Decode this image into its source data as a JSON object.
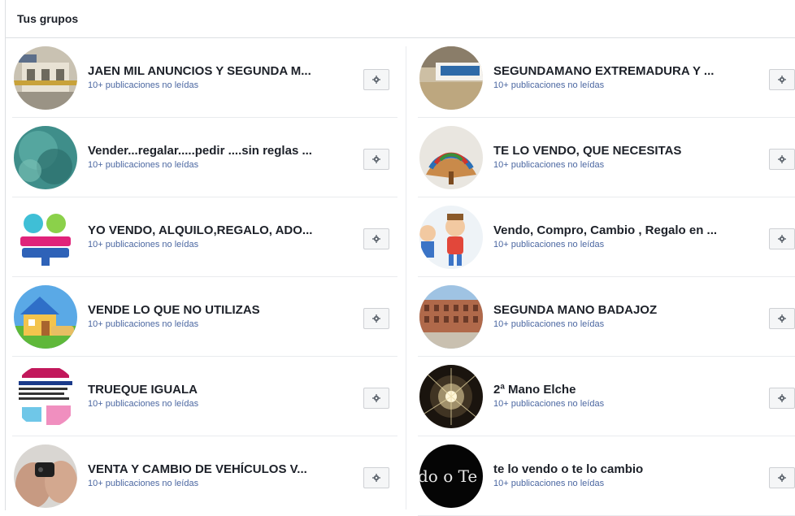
{
  "header": {
    "title": "Tus grupos"
  },
  "left": [
    {
      "name": "JAEN MIL ANUNCIOS Y SEGUNDA M...",
      "sub": "10+ publicaciones no leídas",
      "icon": "house-photo"
    },
    {
      "name": "Vender...regalar.....pedir ....sin reglas ...",
      "sub": "10+ publicaciones no leídas",
      "icon": "water-photo"
    },
    {
      "name": "YO VENDO, ALQUILO,REGALO, ADO...",
      "sub": "10+ publicaciones no leídas",
      "icon": "compra-venta-logo"
    },
    {
      "name": "VENDE LO QUE NO UTILIZAS",
      "sub": "10+ publicaciones no leídas",
      "icon": "house-illustration"
    },
    {
      "name": "TRUEQUE IGUALA",
      "sub": "10+ publicaciones no leídas",
      "icon": "flyer-image"
    },
    {
      "name": "VENTA Y CAMBIO DE VEHÍCULOS V...",
      "sub": "10+ publicaciones no leídas",
      "icon": "car-key-photo"
    }
  ],
  "right": [
    {
      "name": "SEGUNDAMANO EXTREMADURA Y ...",
      "sub": "10+ publicaciones no leídas",
      "icon": "logo-photo"
    },
    {
      "name": "TE LO VENDO, QUE NECESITAS",
      "sub": "10+ publicaciones no leídas",
      "icon": "fan-photo"
    },
    {
      "name": "Vendo, Compro, Cambio , Regalo en ...",
      "sub": "10+ publicaciones no leídas",
      "icon": "cartoon-kids"
    },
    {
      "name": "SEGUNDA MANO BADAJOZ",
      "sub": "10+ publicaciones no leídas",
      "icon": "building-photo"
    },
    {
      "name": "2ª Mano Elche",
      "sub": "10+ publicaciones no leídas",
      "icon": "fireworks-photo"
    },
    {
      "name": "te lo vendo o te lo cambio",
      "sub": "10+ publicaciones no leídas",
      "icon": "text-logo",
      "avatar_text": "do o Te l"
    }
  ],
  "colors": {
    "link": "#4b67a1",
    "border": "#dddfe2",
    "button_bg": "#f5f6f7"
  }
}
